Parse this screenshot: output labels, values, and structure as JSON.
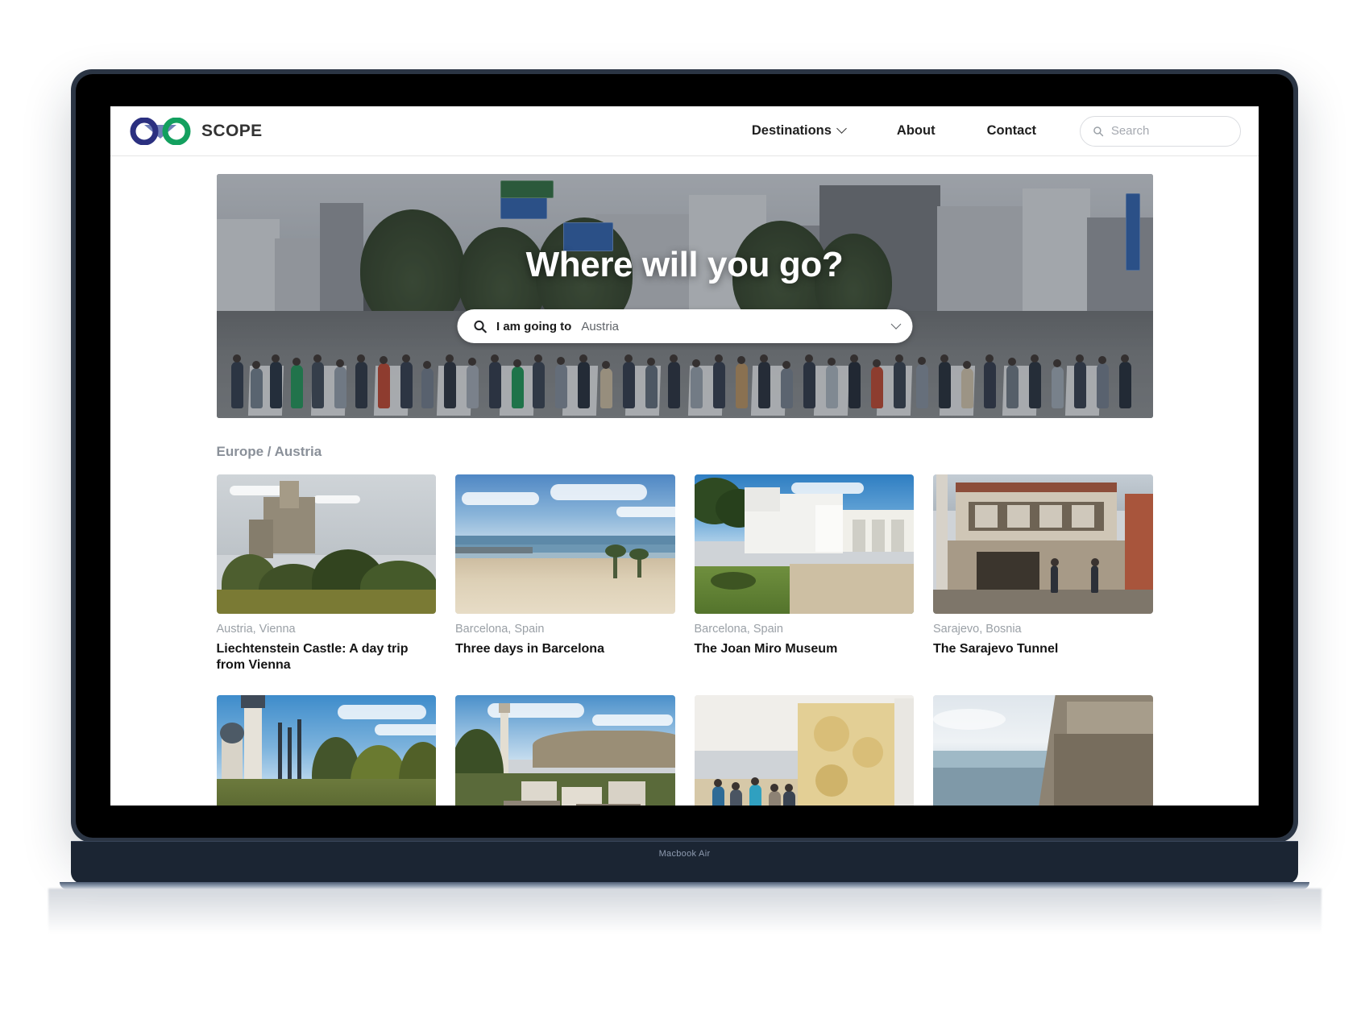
{
  "device": {
    "label": "Macbook Air"
  },
  "nav": {
    "brand": "SCOPE",
    "brand_colors": {
      "left": "#2b3080",
      "right": "#13a05f",
      "bridge": "#6f7fb8"
    },
    "links": [
      {
        "label": "Destinations",
        "has_dropdown": true
      },
      {
        "label": "About",
        "has_dropdown": false
      },
      {
        "label": "Contact",
        "has_dropdown": false
      }
    ],
    "search": {
      "placeholder": "Search",
      "value": ""
    }
  },
  "hero": {
    "title": "Where will you go?",
    "search": {
      "label": "I am going to",
      "value": "Austria",
      "icon": "search-icon",
      "dropdown_icon": "chevron-down-icon"
    }
  },
  "breadcrumb": {
    "text": "Europe / Austria",
    "parts": [
      "Europe",
      "Austria"
    ]
  },
  "cards": [
    {
      "place": "Austria, Vienna",
      "title": "Liechtenstein Castle: A day trip from Vienna",
      "scene": "t1"
    },
    {
      "place": "Barcelona, Spain",
      "title": "Three days in Barcelona",
      "scene": "t2"
    },
    {
      "place": "Barcelona, Spain",
      "title": "The Joan Miro Museum",
      "scene": "t3"
    },
    {
      "place": "Sarajevo, Bosnia",
      "title": "The Sarajevo Tunnel",
      "scene": "t4"
    },
    {
      "place": "",
      "title": "",
      "scene": "t5"
    },
    {
      "place": "",
      "title": "",
      "scene": "t6"
    },
    {
      "place": "",
      "title": "",
      "scene": "t7"
    },
    {
      "place": "",
      "title": "",
      "scene": "t8"
    }
  ],
  "colors": {
    "accent_blue": "#2b3080",
    "accent_green": "#13a05f",
    "text_primary": "#151515",
    "text_muted": "#9aa0a6",
    "breadcrumb": "#8a9099",
    "bezel": "#2b3544",
    "deck": "#1b2533"
  }
}
